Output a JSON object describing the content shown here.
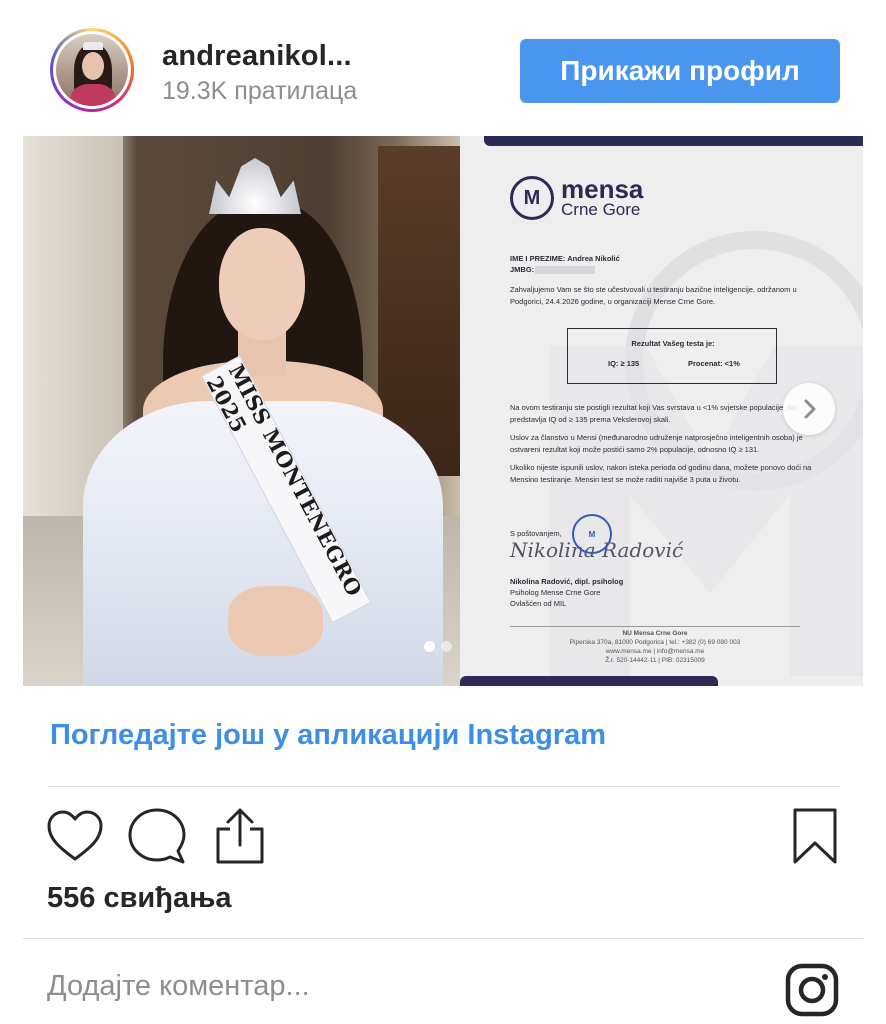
{
  "header": {
    "username": "andreanikol...",
    "followers": "19.3K пратилаца",
    "profile_button": "Прикажи профил"
  },
  "media": {
    "sash_text": "MISS MONTENEGRO 2025",
    "document": {
      "logo_name": "mensa",
      "logo_sub": "Crne Gore",
      "name_line": "IME I PREZIME: Andrea Nikolić",
      "jmbg_line": "JMBG:",
      "intro": "Zahvaljujemo Vam se što ste učestvovali u testiranju bazične inteligencije, održanom u Podgorici, 24.4.2026 godine, u organizaciji Mense Crne Gore.",
      "result_title": "Rezultat Vašeg testa je:",
      "result_iq": "IQ:    ≥ 135",
      "result_percent": "Procenat: <1%",
      "para1": "Na ovom testiranju ste postigli rezultat koji Vas svrstava u <1% svjetske populacije, što predstavlja IQ od ≥ 135 prema Vekslerovoj skali.",
      "para2": "Uslov za članstvo u Mensi (međunarodno udruženje natprosječno inteligentnih osoba) je ostvareni rezultat koji može postići samo 2% populacije, odnosno IQ ≥ 131.",
      "para3": "Ukoliko nijeste ispunili uslov, nakon isteka perioda od godinu dana, možete ponovo doći na Mensino testiranje. Mensin test se može raditi najviše 3 puta u životu.",
      "greeting": "S poštovanjem,",
      "signature": "Nikolina Radović",
      "signer": "Nikolina Radović, dipl. psiholog",
      "signer_role": "Psiholog Mense Crne Gore",
      "signer_auth": "Ovlašćen od MIL",
      "footer_org": "NU Mensa Crne Gore",
      "footer_addr": "Piperska 370a, 81000 Podgorica | tel.: +382 (0) 69 080 003",
      "footer_web": "www.mensa.me | info@mensa.me",
      "footer_ids": "Ž.r. 520-14442-11 | PIB: 02315009"
    },
    "carousel_total": 2,
    "carousel_index": 1
  },
  "view_more": "Погледајте још у апликацији Instagram",
  "icons": {
    "like": "heart-icon",
    "comment": "comment-icon",
    "share": "share-icon",
    "save": "bookmark-icon",
    "instagram": "instagram-icon",
    "next": "chevron-right-icon"
  },
  "likes": "556 свиђања",
  "comment_placeholder": "Додајте коментар...",
  "colors": {
    "accent": "#4a95ee",
    "link": "#3d8ee6",
    "doc_navy": "#2b2b55"
  }
}
